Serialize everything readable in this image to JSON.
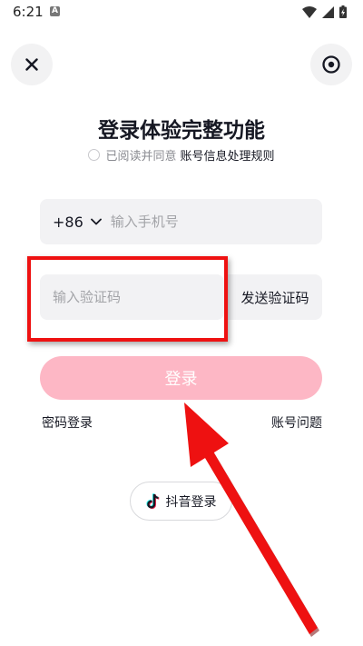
{
  "status_bar": {
    "time": "6:21",
    "notification_badge": "A",
    "icons": [
      "wifi-icon",
      "signal-icon",
      "battery-charging-icon"
    ]
  },
  "header": {
    "close_icon": "close-icon",
    "settings_icon": "target-icon"
  },
  "title": "登录体验完整功能",
  "agreement": {
    "text": "已阅读并同意",
    "link": "账号信息处理规则"
  },
  "phone": {
    "country_code": "+86",
    "placeholder": "输入手机号"
  },
  "code": {
    "placeholder": "输入验证码",
    "send_label": "发送验证码"
  },
  "login": {
    "label": "登录",
    "color": "#fdb7c5"
  },
  "links": {
    "password_login": "密码登录",
    "account_issue": "账号问题"
  },
  "douyin": {
    "label": "抖音登录",
    "icon": "tiktok-note-icon"
  },
  "annotation": {
    "color": "#ee1111"
  }
}
